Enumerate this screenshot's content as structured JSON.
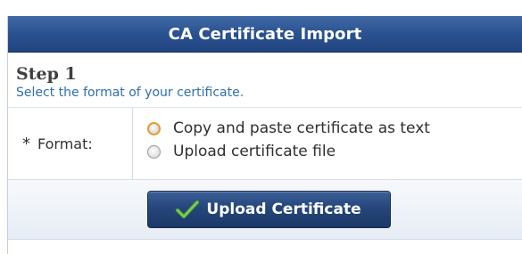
{
  "dialog": {
    "title": "CA Certificate Import"
  },
  "step": {
    "heading": "Step 1",
    "description": "Select the format of your certificate."
  },
  "format": {
    "required_marker": "*",
    "label": "Format:",
    "options": [
      {
        "label": "Copy and paste certificate as text",
        "selected": true
      },
      {
        "label": "Upload certificate file",
        "selected": false
      }
    ]
  },
  "actions": {
    "upload_label": "Upload Certificate",
    "icon": "checkmark-icon"
  },
  "colors": {
    "titlebar": "#2a5190",
    "step_desc": "#2e6fb1",
    "button": "#26467b",
    "check": "#5cb531",
    "selected_radio_border": "#e89a2e"
  }
}
